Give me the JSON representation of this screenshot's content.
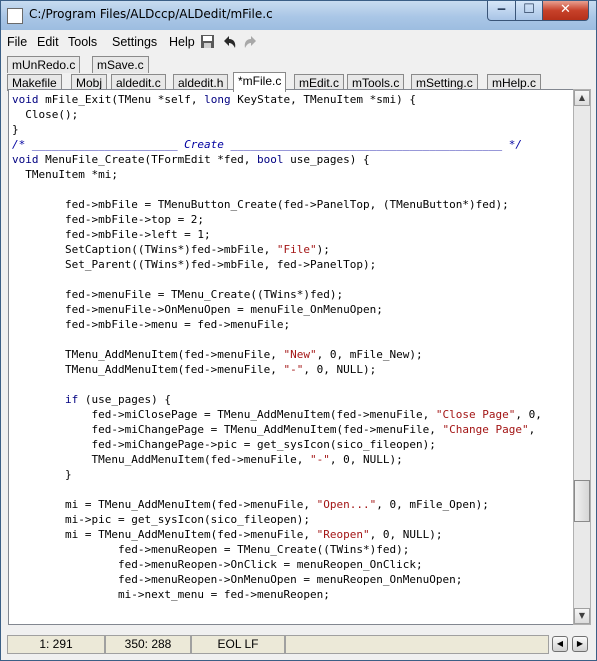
{
  "window": {
    "title": "C:/Program Files/ALDccp/ALDedit/mFile.c"
  },
  "menu": {
    "items": [
      "File",
      "Edit",
      "Tools",
      "Settings",
      "Help"
    ],
    "toolbar_icons": [
      "save-icon",
      "undo-icon",
      "redo-icon"
    ]
  },
  "tabs_row1": [
    "mUnRedo.c",
    "mSave.c"
  ],
  "tabs_row2": [
    "Makefile",
    "Mobj",
    "aldedit.c",
    "aldedit.h",
    "*mFile.c",
    "mEdit.c",
    "mTools.c",
    "mSetting.c",
    "mHelp.c"
  ],
  "active_tab": "*mFile.c",
  "code": [
    [
      {
        "t": "void ",
        "c": "kw"
      },
      {
        "t": "mFile_Exit(TMenu *self, "
      },
      {
        "t": "long ",
        "c": "kw"
      },
      {
        "t": "KeyState, TMenuItem *smi) {"
      }
    ],
    [
      {
        "t": "  Close();"
      }
    ],
    [
      {
        "t": "}"
      }
    ],
    [
      {
        "t": "/* ______________________ Create _________________________________________ */",
        "c": "cm"
      }
    ],
    [
      {
        "t": "void ",
        "c": "kw"
      },
      {
        "t": "MenuFile_Create(TFormEdit *fed, "
      },
      {
        "t": "bool ",
        "c": "kw"
      },
      {
        "t": "use_pages) {"
      }
    ],
    [
      {
        "t": "  TMenuItem *mi;"
      }
    ],
    [
      {
        "t": ""
      }
    ],
    [
      {
        "t": "        fed->mbFile = TMenuButton_Create(fed->PanelTop, (TMenuButton*)fed);"
      }
    ],
    [
      {
        "t": "        fed->mbFile->top = 2;"
      }
    ],
    [
      {
        "t": "        fed->mbFile->left = 1;"
      }
    ],
    [
      {
        "t": "        SetCaption((TWins*)fed->mbFile, "
      },
      {
        "t": "\"File\"",
        "c": "str"
      },
      {
        "t": ");"
      }
    ],
    [
      {
        "t": "        Set_Parent((TWins*)fed->mbFile, fed->PanelTop);"
      }
    ],
    [
      {
        "t": ""
      }
    ],
    [
      {
        "t": "        fed->menuFile = TMenu_Create((TWins*)fed);"
      }
    ],
    [
      {
        "t": "        fed->menuFile->OnMenuOpen = menuFile_OnMenuOpen;"
      }
    ],
    [
      {
        "t": "        fed->mbFile->menu = fed->menuFile;"
      }
    ],
    [
      {
        "t": ""
      }
    ],
    [
      {
        "t": "        TMenu_AddMenuItem(fed->menuFile, "
      },
      {
        "t": "\"New\"",
        "c": "str"
      },
      {
        "t": ", 0, mFile_New);"
      }
    ],
    [
      {
        "t": "        TMenu_AddMenuItem(fed->menuFile, "
      },
      {
        "t": "\"-\"",
        "c": "str"
      },
      {
        "t": ", 0, NULL);"
      }
    ],
    [
      {
        "t": ""
      }
    ],
    [
      {
        "t": "        "
      },
      {
        "t": "if ",
        "c": "kw"
      },
      {
        "t": "(use_pages) {"
      }
    ],
    [
      {
        "t": "            fed->miClosePage = TMenu_AddMenuItem(fed->menuFile, "
      },
      {
        "t": "\"Close Page\"",
        "c": "str"
      },
      {
        "t": ", 0,"
      }
    ],
    [
      {
        "t": "            fed->miChangePage = TMenu_AddMenuItem(fed->menuFile, "
      },
      {
        "t": "\"Change Page\"",
        "c": "str"
      },
      {
        "t": ","
      }
    ],
    [
      {
        "t": "            fed->miChangePage->pic = get_sysIcon(sico_fileopen);"
      }
    ],
    [
      {
        "t": "            TMenu_AddMenuItem(fed->menuFile, "
      },
      {
        "t": "\"-\"",
        "c": "str"
      },
      {
        "t": ", 0, NULL);"
      }
    ],
    [
      {
        "t": "        }"
      }
    ],
    [
      {
        "t": ""
      }
    ],
    [
      {
        "t": "        mi = TMenu_AddMenuItem(fed->menuFile, "
      },
      {
        "t": "\"Open...\"",
        "c": "str"
      },
      {
        "t": ", 0, mFile_Open);"
      }
    ],
    [
      {
        "t": "        mi->pic = get_sysIcon(sico_fileopen);"
      }
    ],
    [
      {
        "t": "        mi = TMenu_AddMenuItem(fed->menuFile, "
      },
      {
        "t": "\"Reopen\"",
        "c": "str"
      },
      {
        "t": ", 0, NULL);"
      }
    ],
    [
      {
        "t": "                fed->menuReopen = TMenu_Create((TWins*)fed);"
      }
    ],
    [
      {
        "t": "                fed->menuReopen->OnClick = menuReopen_OnClick;"
      }
    ],
    [
      {
        "t": "                fed->menuReopen->OnMenuOpen = menuReopen_OnMenuOpen;"
      }
    ],
    [
      {
        "t": "                mi->next_menu = fed->menuReopen;"
      }
    ]
  ],
  "status": {
    "line": "1:  291",
    "pos": "350:  288",
    "eol": "EOL LF"
  }
}
